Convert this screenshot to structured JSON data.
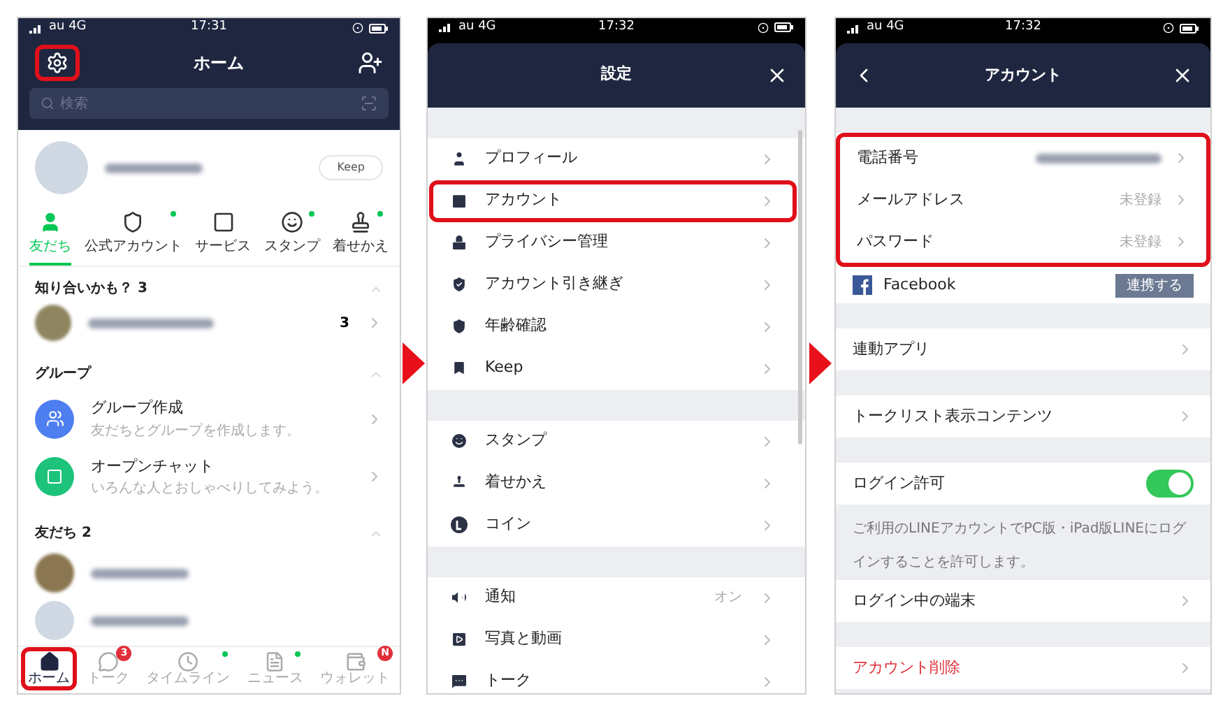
{
  "home": {
    "status": {
      "carrier": "au 4G",
      "time": "17:31"
    },
    "title": "ホーム",
    "settings_highlighted": true,
    "search": {
      "placeholder": "検索"
    },
    "profile": {
      "keep_button": "Keep"
    },
    "services": [
      {
        "kind": "friends",
        "label": "友だち",
        "selected": true,
        "new": false
      },
      {
        "kind": "official",
        "label": "公式アカウント",
        "selected": false,
        "new": true
      },
      {
        "kind": "service",
        "label": "サービス",
        "selected": false,
        "new": false
      },
      {
        "kind": "sticker",
        "label": "スタンプ",
        "selected": false,
        "new": true
      },
      {
        "kind": "theme",
        "label": "着せかえ",
        "selected": false,
        "new": true
      }
    ],
    "suggestions": {
      "title": "知り合いかも？ 3",
      "count": "3"
    },
    "groups": {
      "title": "グループ",
      "items": [
        {
          "kind": "group",
          "title": "グループ作成",
          "subtitle": "友だちとグループを作成します。"
        },
        {
          "kind": "openchat",
          "title": "オープンチャット",
          "subtitle": "いろんな人とおしゃべりしてみよう。"
        }
      ]
    },
    "friends": {
      "title": "友だち 2",
      "rows": [
        {
          "photo": true
        },
        {
          "photo": false
        }
      ]
    },
    "tabs": [
      {
        "kind": "home",
        "label": "ホーム",
        "selected": true,
        "highlighted": true,
        "dot": false
      },
      {
        "kind": "talk",
        "label": "トーク",
        "selected": false,
        "highlighted": false,
        "badge": "3",
        "dot": false
      },
      {
        "kind": "timeline",
        "label": "タイムライン",
        "selected": false,
        "highlighted": false,
        "dot": true
      },
      {
        "kind": "news",
        "label": "ニュース",
        "selected": false,
        "highlighted": false,
        "dot": true
      },
      {
        "kind": "wallet",
        "label": "ウォレット",
        "selected": false,
        "highlighted": false,
        "badge": "N",
        "dot": false
      }
    ]
  },
  "settings": {
    "status": {
      "carrier": "au 4G",
      "time": "17:32"
    },
    "title": "設定",
    "groups": [
      {
        "items": [
          {
            "kind": "profile",
            "label": "プロフィール",
            "highlighted": false
          },
          {
            "kind": "account",
            "label": "アカウント",
            "highlighted": true
          },
          {
            "kind": "privacy",
            "label": "プライバシー管理",
            "highlighted": false
          },
          {
            "kind": "transfer",
            "label": "アカウント引き継ぎ",
            "highlighted": false
          },
          {
            "kind": "age",
            "label": "年齢確認",
            "highlighted": false
          },
          {
            "kind": "keep",
            "label": "Keep",
            "highlighted": false
          }
        ]
      },
      {
        "items": [
          {
            "kind": "sticker",
            "label": "スタンプ",
            "highlighted": false
          },
          {
            "kind": "theme",
            "label": "着せかえ",
            "highlighted": false
          },
          {
            "kind": "coin",
            "label": "コイン",
            "highlighted": false
          }
        ]
      },
      {
        "items": [
          {
            "kind": "notification",
            "label": "通知",
            "value": "オン",
            "highlighted": false
          },
          {
            "kind": "media",
            "label": "写真と動画",
            "highlighted": false
          },
          {
            "kind": "talk",
            "label": "トーク",
            "highlighted": false
          }
        ]
      }
    ]
  },
  "account": {
    "status": {
      "carrier": "au 4G",
      "time": "17:32"
    },
    "title": "アカウント",
    "sections": [
      {
        "rows": [
          {
            "kind": "nav",
            "label": "電話番号",
            "value_hidden": true,
            "highlighted": true
          },
          {
            "kind": "nav",
            "label": "メールアドレス",
            "value": "未登録",
            "highlighted": true
          },
          {
            "kind": "nav",
            "label": "パスワード",
            "value": "未登録",
            "highlighted": true
          },
          {
            "kind": "facebook",
            "label": "Facebook",
            "button": "連携する",
            "highlighted": false
          }
        ]
      },
      {
        "rows": [
          {
            "kind": "nav",
            "label": "連動アプリ"
          }
        ]
      },
      {
        "rows": [
          {
            "kind": "nav",
            "label": "トークリスト表示コンテンツ"
          }
        ]
      },
      {
        "rows": [
          {
            "kind": "toggle",
            "label": "ログイン許可",
            "on": true,
            "note": "ご利用のLINEアカウントでPC版・iPad版LINEにログインすることを許可します。"
          },
          {
            "kind": "nav",
            "label": "ログイン中の端末"
          }
        ]
      },
      {
        "rows": [
          {
            "kind": "danger",
            "label": "アカウント削除"
          }
        ]
      }
    ]
  }
}
